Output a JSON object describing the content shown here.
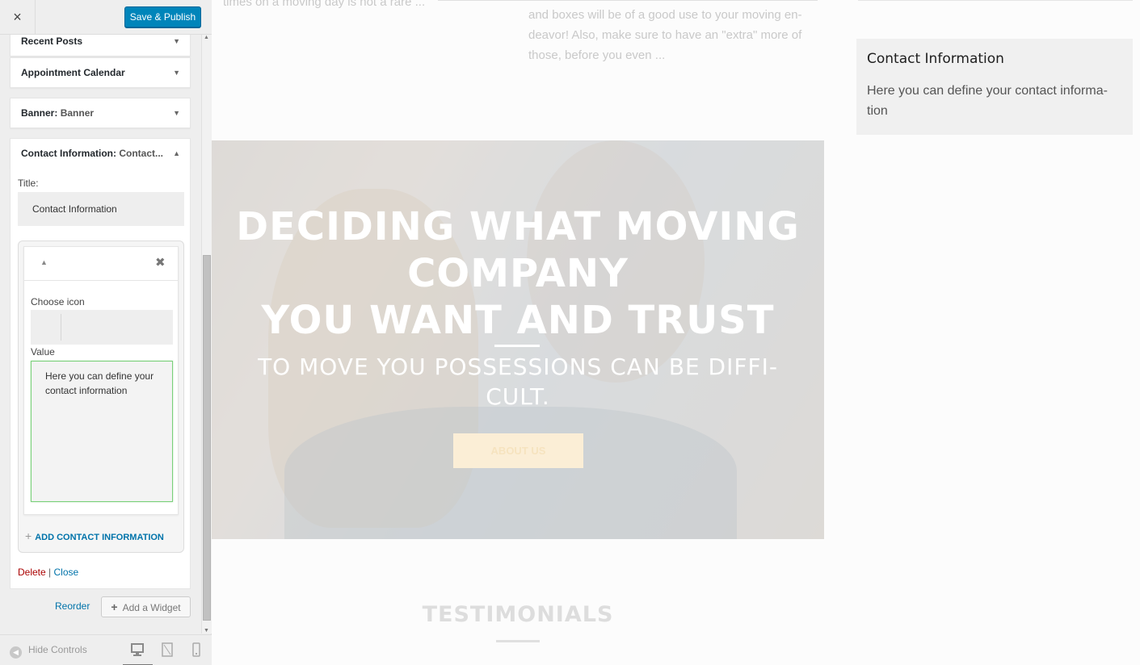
{
  "customizer": {
    "close_icon": "×",
    "save_publish": "Save & Publish",
    "widgets": [
      {
        "title": "Recent Posts",
        "subtitle": ""
      },
      {
        "title": "Appointment Calendar",
        "subtitle": ""
      },
      {
        "title": "Banner:",
        "subtitle": "Banner"
      },
      {
        "title": "Contact Information:",
        "subtitle": "Contact..."
      }
    ],
    "contact_form": {
      "title_label": "Title:",
      "title_value": "Contact Information",
      "choose_icon_label": "Choose icon",
      "value_label": "Value",
      "value_text": "Here you can define your contact information",
      "add_contact_label": "ADD CONTACT INFORMATION",
      "delete_label": "Delete",
      "separator": "|",
      "close_label": "Close"
    },
    "reorder_label": "Reorder",
    "add_widget_label": "Add a Widget",
    "hide_controls_label": "Hide Controls"
  },
  "preview": {
    "top_left_text": "times on a moving day is not a rare ...",
    "excerpt": "and boxes will be of a good use to your moving en-deavor! Also, make sure to have an \"extra\" more of those, before you even ...",
    "hero": {
      "title_line1": "DECIDING WHAT MOVING COMPANY",
      "title_line2": "YOU WANT AND TRUST",
      "subtitle": "TO MOVE YOU POSSESSIONS CAN BE DIFFI-CULT.",
      "button": "ABOUT US"
    },
    "testimonials_heading": "TESTIMONIALS",
    "contact_widget": {
      "title": "Contact Information",
      "text": "Here you can define your contact informa-tion"
    }
  },
  "colors": {
    "primary_button": "#0085ba",
    "link": "#0073aa",
    "delete": "#aa0000",
    "textarea_focus_border": "#7ad07a",
    "hero_button_bg": "#fbeed6"
  },
  "icons": [
    "close-icon",
    "chevron-down-icon",
    "chevron-up-icon",
    "remove-icon",
    "plus-icon",
    "arrow-left-circle-icon",
    "desktop-icon",
    "tablet-icon",
    "mobile-icon"
  ]
}
